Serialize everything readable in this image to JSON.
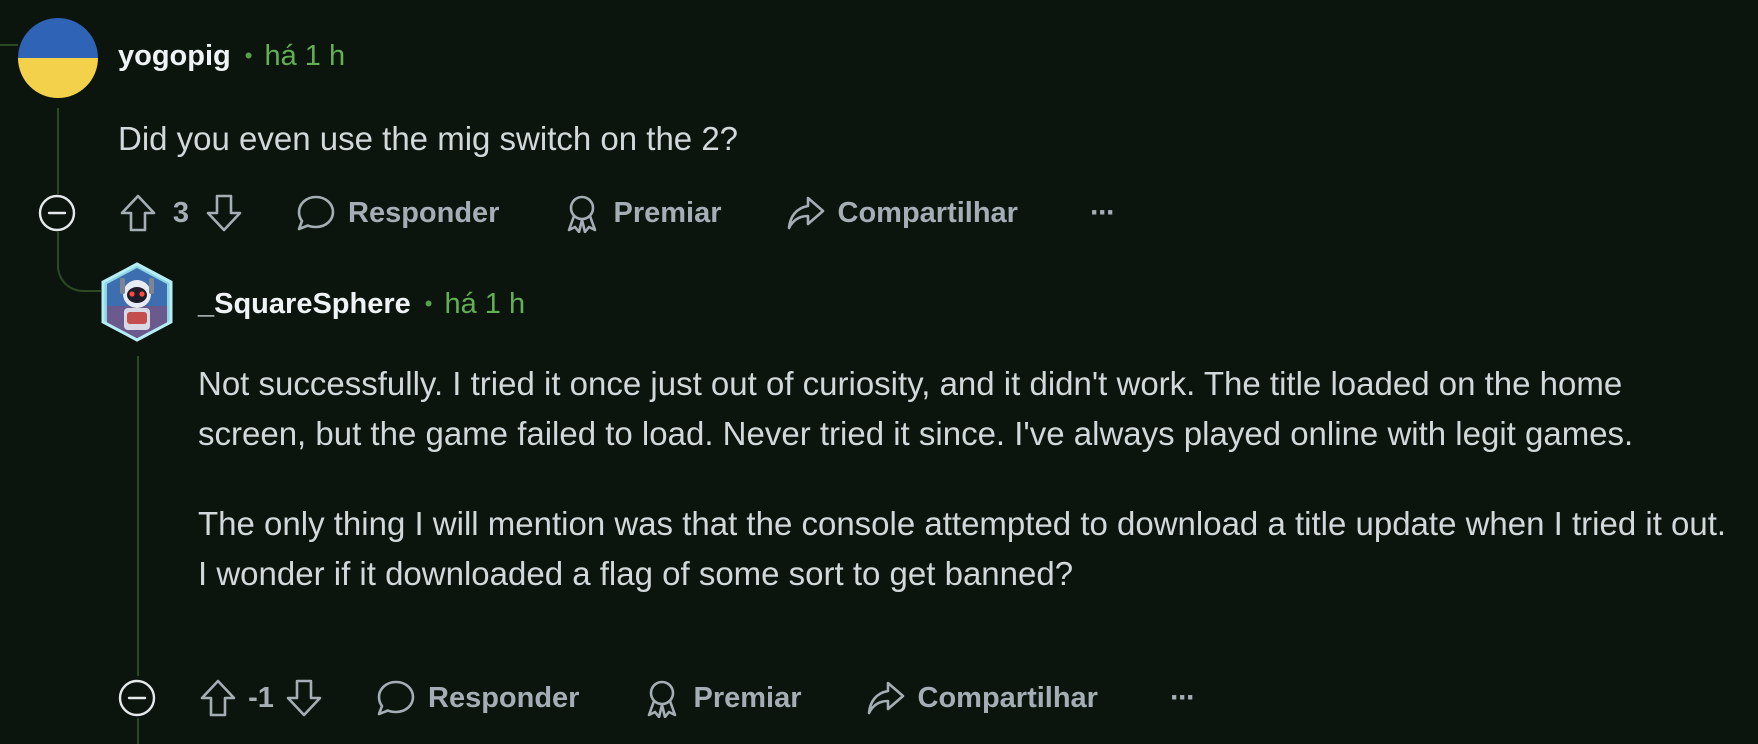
{
  "comments": [
    {
      "user": "yogopig",
      "time": "há 1 h",
      "body": [
        "Did you even use the mig switch on the 2?"
      ],
      "score": "3",
      "actions": {
        "reply": "Responder",
        "award": "Premiar",
        "share": "Compartilhar",
        "more": "···"
      }
    },
    {
      "user": "_SquareSphere",
      "time": "há 1 h",
      "body": [
        "Not successfully. I tried it once just out of curiosity, and it didn't work. The title loaded on the home screen, but the game failed to load. Never tried it since. I've always played online with legit games.",
        "The only thing I will mention was that the console attempted to download a title update when I tried it out. I wonder if it downloaded a flag of some sort to get banned?"
      ],
      "score": "-1",
      "actions": {
        "reply": "Responder",
        "award": "Premiar",
        "share": "Compartilhar",
        "more": "···"
      }
    }
  ],
  "meta_separator": "•",
  "colors": {
    "background": "#0b150e",
    "thread_line": "#2b4a24",
    "time_green": "#62b052",
    "text": "#d3d8db",
    "action_gray": "#a4aeb4"
  }
}
